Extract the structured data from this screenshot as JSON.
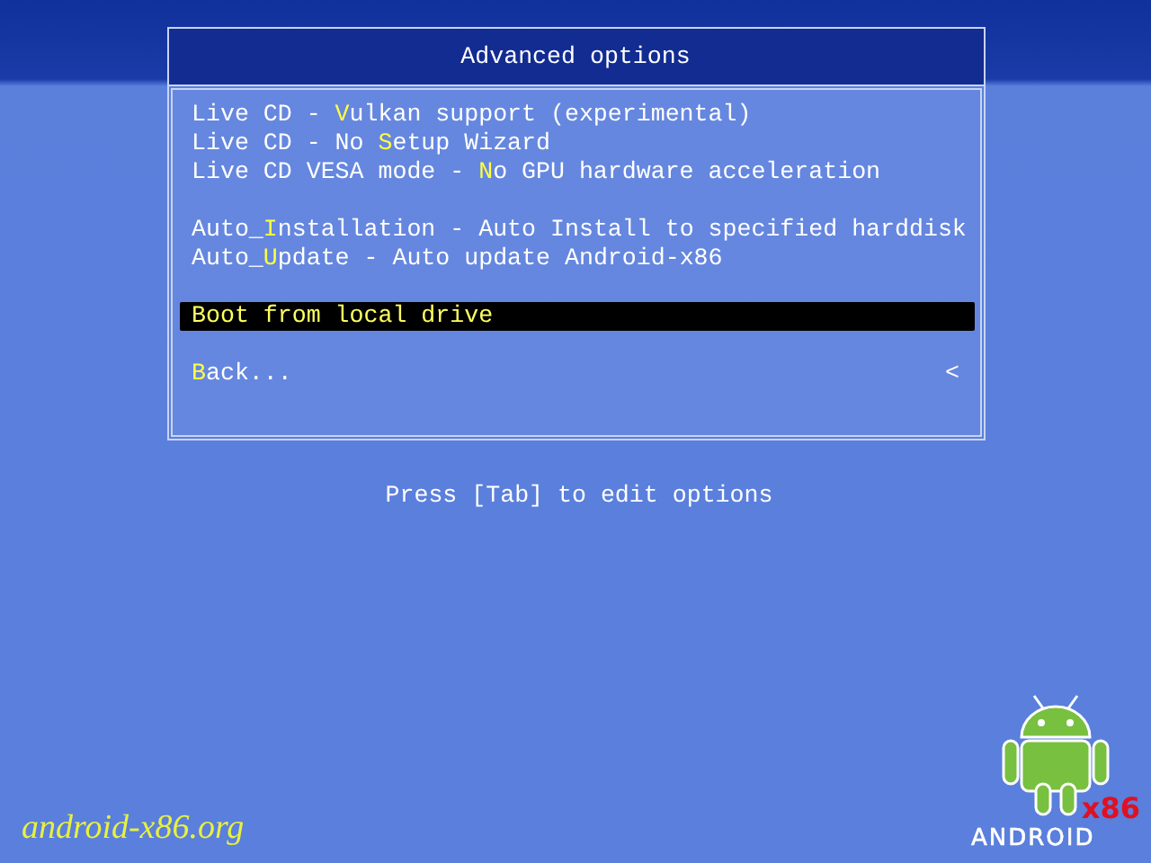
{
  "menu": {
    "title": "Advanced options",
    "items": [
      {
        "kind": "entry",
        "before": "Live CD - ",
        "hotkey": "V",
        "after": "ulkan support (experimental)",
        "selected": false
      },
      {
        "kind": "entry",
        "before": "Live CD - No ",
        "hotkey": "S",
        "after": "etup Wizard",
        "selected": false
      },
      {
        "kind": "entry",
        "before": "Live CD VESA mode - ",
        "hotkey": "N",
        "after": "o GPU hardware acceleration",
        "selected": false
      },
      {
        "kind": "blank"
      },
      {
        "kind": "entry",
        "before": "Auto_",
        "hotkey": "I",
        "after": "nstallation - Auto Install to specified harddisk",
        "selected": false
      },
      {
        "kind": "entry",
        "before": "Auto_",
        "hotkey": "U",
        "after": "pdate - Auto update Android-x86",
        "selected": false
      },
      {
        "kind": "blank"
      },
      {
        "kind": "entry",
        "before": "Boot from local drive",
        "selected": true
      },
      {
        "kind": "blank"
      },
      {
        "kind": "entry",
        "hotkey": "B",
        "after": "ack...",
        "submenu_mark": "<",
        "selected": false
      }
    ]
  },
  "hint": "Press [Tab] to edit options",
  "website": "android-x86.org",
  "logo": {
    "badge": "x86",
    "wordmark": "ANDROID"
  }
}
